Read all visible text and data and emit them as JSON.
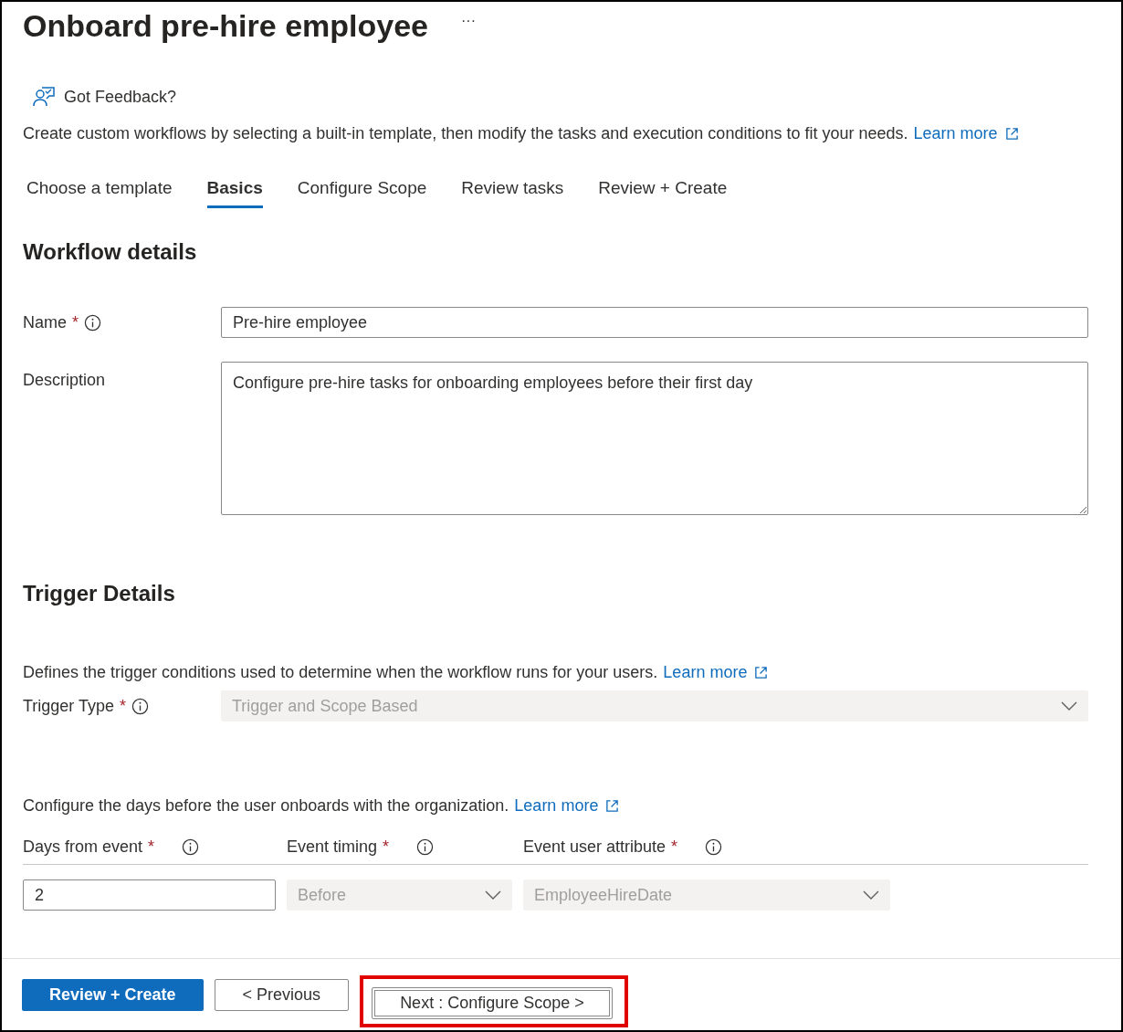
{
  "title": "Onboard pre-hire employee",
  "more_button": "···",
  "feedback": "Got Feedback?",
  "intro": {
    "text": "Create custom workflows by selecting a built-in template, then modify the tasks and execution conditions to fit your needs.",
    "link": "Learn more"
  },
  "tabs": [
    {
      "label": "Choose a template",
      "selected": false
    },
    {
      "label": "Basics",
      "selected": true
    },
    {
      "label": "Configure Scope",
      "selected": false
    },
    {
      "label": "Review tasks",
      "selected": false
    },
    {
      "label": "Review + Create",
      "selected": false
    }
  ],
  "workflow_details": {
    "heading": "Workflow details",
    "name": {
      "label": "Name",
      "required_mark": "*",
      "value": "Pre-hire employee"
    },
    "description": {
      "label": "Description",
      "value": "Configure pre-hire tasks for onboarding employees before their first day"
    }
  },
  "trigger_details": {
    "heading": "Trigger Details",
    "intro": {
      "text": "Defines the trigger conditions used to determine when the workflow runs for your users.",
      "link": "Learn more"
    },
    "trigger_type": {
      "label": "Trigger Type",
      "required_mark": "*",
      "value": "Trigger and Scope Based",
      "disabled": true
    },
    "days_intro": {
      "text": "Configure the days before the user onboards with the organization.",
      "link": "Learn more"
    },
    "fields": [
      {
        "kind": "text",
        "label": "Days from event",
        "required_mark": "*",
        "value": "2"
      },
      {
        "kind": "dropdown",
        "label": "Event timing",
        "required_mark": "*",
        "value": "Before",
        "disabled": true
      },
      {
        "kind": "dropdown",
        "label": "Event user attribute",
        "required_mark": "*",
        "value": "EmployeeHireDate",
        "disabled": true
      }
    ]
  },
  "footer": [
    {
      "kind": "primary",
      "label": "Review + Create",
      "highlighted": false
    },
    {
      "kind": "default",
      "label": "< Previous",
      "highlighted": false
    },
    {
      "kind": "default",
      "label": "Next : Configure Scope >",
      "highlighted": true
    }
  ]
}
